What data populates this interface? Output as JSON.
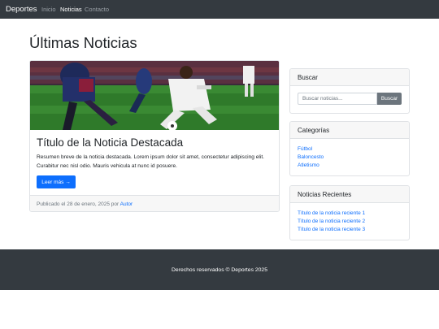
{
  "navbar": {
    "brand": "Deportes",
    "links": [
      {
        "label": "Inicio",
        "active": false
      },
      {
        "label": "Noticias",
        "active": true
      },
      {
        "label": "Contacto",
        "active": false
      }
    ]
  },
  "page_title": "Últimas Noticias",
  "featured": {
    "image_alt": "soccer-players-photo",
    "title": "Título de la Noticia Destacada",
    "summary": "Resumen breve de la noticia destacada. Lorem ipsum dolor sit amet, consectetur adipiscing elit. Curabitur nec nisl odio. Mauris vehicula at nunc id posuere.",
    "button_label": "Leer más →",
    "published_prefix": "Publicado el 28 de enero, 2025 por ",
    "author": "Autor"
  },
  "search": {
    "header": "Buscar",
    "placeholder": "Buscar noticias...",
    "button_label": "Buscar"
  },
  "categories": {
    "header": "Categorías",
    "items": [
      "Fútbol",
      "Baloncesto",
      "Atletismo"
    ]
  },
  "recent": {
    "header": "Noticias Recientes",
    "items": [
      "Título de la noticia reciente 1",
      "Título de la noticia reciente 2",
      "Título de la noticia reciente 3"
    ]
  },
  "footer": {
    "text": "Derechos reservados © Deportes 2025"
  },
  "colors": {
    "navbar_bg": "#343a40",
    "primary": "#0d6efd",
    "secondary": "#6c757d",
    "pitch_green": "#2f7a2a"
  }
}
